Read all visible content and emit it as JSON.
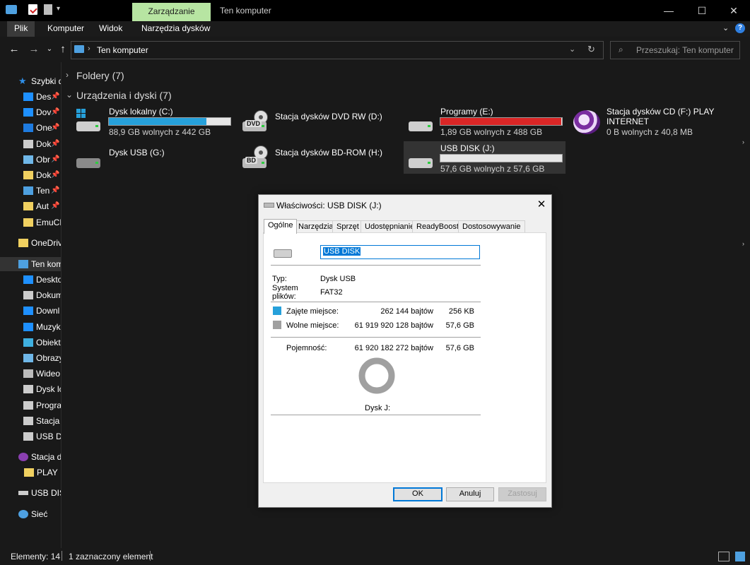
{
  "titlebar": {
    "context_tab": "Zarządzanie",
    "title": "Ten komputer"
  },
  "ribbon": {
    "tabs": [
      "Plik",
      "Komputer",
      "Widok",
      "Narzędzia dysków"
    ]
  },
  "nav": {
    "address": "Ten komputer",
    "search_placeholder": "Przeszukaj: Ten komputer"
  },
  "sidebar": {
    "quick_access": "Szybki d",
    "items": [
      {
        "label": "Des",
        "pinned": "📌",
        "icon": "desktop-icon",
        "color": "#1e90ff"
      },
      {
        "label": "Dov",
        "pinned": "📌",
        "icon": "download-icon",
        "color": "#1e90ff"
      },
      {
        "label": "One",
        "pinned": "📌",
        "icon": "onedrive-icon",
        "color": "#1e7be0"
      },
      {
        "label": "Dok",
        "pinned": "📌",
        "icon": "document-icon",
        "color": "#cccccc"
      },
      {
        "label": "Obr",
        "pinned": "📌",
        "icon": "pictures-icon",
        "color": "#6fb7e8"
      },
      {
        "label": "Dok",
        "pinned": "📌",
        "icon": "folder-icon",
        "color": "#f0d060"
      },
      {
        "label": "Ten",
        "pinned": "📌",
        "icon": "computer-icon",
        "color": "#4ea0e0"
      },
      {
        "label": "Aut",
        "pinned": "📌",
        "icon": "folder-icon",
        "color": "#f0d060"
      },
      {
        "label": "EmuCF",
        "pinned": "",
        "icon": "folder-icon",
        "color": "#f0d060"
      }
    ],
    "onedrive": "OneDriv",
    "this_pc": "Ten kom",
    "pc_items": [
      {
        "label": "Deskto",
        "icon": "desktop-icon",
        "color": "#1e90ff"
      },
      {
        "label": "Dokum",
        "icon": "document-icon",
        "color": "#cccccc"
      },
      {
        "label": "Downl",
        "icon": "download-icon",
        "color": "#1e90ff"
      },
      {
        "label": "Muzyk",
        "icon": "music-icon",
        "color": "#1e90ff"
      },
      {
        "label": "Obiekt",
        "icon": "3d-objects-icon",
        "color": "#3fb0e0"
      },
      {
        "label": "Obrazy",
        "icon": "pictures-icon",
        "color": "#6fb7e8"
      },
      {
        "label": "Wideo",
        "icon": "video-icon",
        "color": "#bbbbbb"
      },
      {
        "label": "Dysk lc",
        "icon": "drive-icon",
        "color": "#cccccc"
      },
      {
        "label": "Progra",
        "icon": "drive-icon",
        "color": "#cccccc"
      },
      {
        "label": "Stacja",
        "icon": "dvd-icon",
        "color": "#cccccc"
      },
      {
        "label": "USB DI",
        "icon": "usb-drive-icon",
        "color": "#cccccc"
      }
    ],
    "cd_drive": "Stacja dy",
    "cd_folder": "PLAY IN",
    "usb": "USB DISK",
    "network": "Sieć"
  },
  "content": {
    "folders_header": "Foldery (7)",
    "devices_header": "Urządzenia i dyski (7)",
    "drives": [
      {
        "name": "Dysk lokalny (C:)",
        "info": "88,9 GB wolnych z 442 GB",
        "used_fraction": 0.8,
        "bar_color": "#26a0da",
        "icon": "windows-drive-icon"
      },
      {
        "name": "Stacja dysków DVD RW (D:)",
        "info": "",
        "icon": "dvd-drive-icon",
        "tag": "DVD"
      },
      {
        "name": "Programy (E:)",
        "info": "1,89 GB wolnych z 488 GB",
        "used_fraction": 0.996,
        "bar_color": "#da2626",
        "icon": "drive-icon"
      },
      {
        "name": "Stacja dysków CD (F:) PLAY",
        "name2": "INTERNET",
        "info": "0 B wolnych z 40,8 MB",
        "icon": "play-logo-icon"
      },
      {
        "name": "Dysk USB (G:)",
        "info": "",
        "icon": "usb-drive-icon"
      },
      {
        "name": "Stacja dysków BD-ROM (H:)",
        "info": "",
        "icon": "bd-drive-icon",
        "tag": "BD"
      },
      {
        "name": "USB DISK (J:)",
        "info": "57,6 GB wolnych z 57,6 GB",
        "used_fraction": 0.0,
        "bar_color": "#26a0da",
        "icon": "usb-drive-icon"
      }
    ]
  },
  "status": {
    "elements": "Elementy: 14",
    "selected": "1 zaznaczony element"
  },
  "dialog": {
    "title": "Właściwości: USB DISK (J:)",
    "tabs": [
      "Ogólne",
      "Narzędzia",
      "Sprzęt",
      "Udostępnianie",
      "ReadyBoost",
      "Dostosowywanie"
    ],
    "name_value": "USB DISK",
    "type_label": "Typ:",
    "type_value": "Dysk USB",
    "fs_label1": "System",
    "fs_label2": "plików:",
    "fs_value": "FAT32",
    "used_label": "Zajęte miejsce:",
    "used_bytes": "262 144 bajtów",
    "used_size": "256 KB",
    "used_color": "#26a0da",
    "free_label": "Wolne miejsce:",
    "free_bytes": "61 919 920 128 bajtów",
    "free_size": "57,6 GB",
    "free_color": "#a0a0a0",
    "capacity_label": "Pojemność:",
    "capacity_bytes": "61 920 182 272 bajtów",
    "capacity_size": "57,6 GB",
    "disk_label": "Dysk J:",
    "ok": "OK",
    "cancel": "Anuluj",
    "apply": "Zastosuj"
  }
}
